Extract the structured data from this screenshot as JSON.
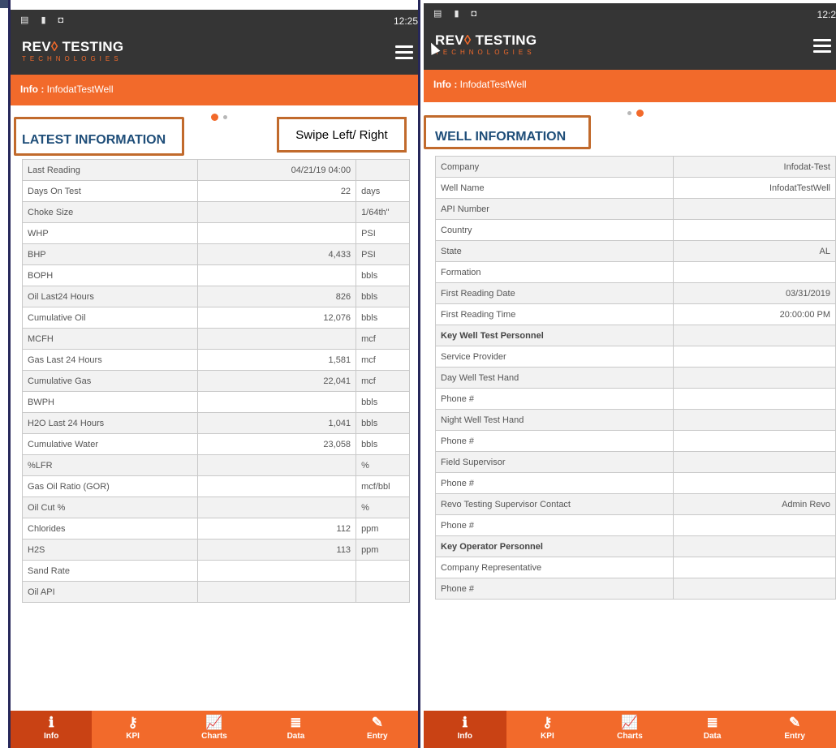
{
  "left": {
    "time": "12:25",
    "brand": {
      "part1": "REV",
      "drop": "◊",
      "part2": " TESTING",
      "sub": "TECHNOLOGIES"
    },
    "info_label": "Info :",
    "well_name": "InfodatTestWell",
    "heading": "LATEST INFORMATION",
    "swipe_hint": "Swipe Left/ Right",
    "rows": [
      {
        "label": "Last Reading",
        "value": "04/21/19 04:00",
        "unit": ""
      },
      {
        "label": "Days On Test",
        "value": "22",
        "unit": "days"
      },
      {
        "label": "Choke Size",
        "value": "",
        "unit": "1/64th\""
      },
      {
        "label": "WHP",
        "value": "",
        "unit": "PSI"
      },
      {
        "label": "BHP",
        "value": "4,433",
        "unit": "PSI"
      },
      {
        "label": "BOPH",
        "value": "",
        "unit": "bbls"
      },
      {
        "label": "Oil Last24 Hours",
        "value": "826",
        "unit": "bbls"
      },
      {
        "label": "Cumulative Oil",
        "value": "12,076",
        "unit": "bbls"
      },
      {
        "label": "MCFH",
        "value": "",
        "unit": "mcf"
      },
      {
        "label": "Gas Last 24 Hours",
        "value": "1,581",
        "unit": "mcf"
      },
      {
        "label": "Cumulative Gas",
        "value": "22,041",
        "unit": "mcf"
      },
      {
        "label": "BWPH",
        "value": "",
        "unit": "bbls"
      },
      {
        "label": "H2O Last 24 Hours",
        "value": "1,041",
        "unit": "bbls"
      },
      {
        "label": "Cumulative Water",
        "value": "23,058",
        "unit": "bbls"
      },
      {
        "label": "%LFR",
        "value": "",
        "unit": "%"
      },
      {
        "label": "Gas Oil Ratio (GOR)",
        "value": "",
        "unit": "mcf/bbl"
      },
      {
        "label": "Oil Cut %",
        "value": "",
        "unit": "%"
      },
      {
        "label": "Chlorides",
        "value": "112",
        "unit": "ppm"
      },
      {
        "label": "H2S",
        "value": "113",
        "unit": "ppm"
      },
      {
        "label": "Sand Rate",
        "value": "",
        "unit": ""
      },
      {
        "label": "Oil API",
        "value": "",
        "unit": ""
      }
    ]
  },
  "right": {
    "time": "12:2",
    "brand": {
      "part1": "REV",
      "drop": "◊",
      "part2": " TESTING",
      "sub": "TECHNOLOGIES"
    },
    "info_label": "Info :",
    "well_name": "InfodatTestWell",
    "heading": "WELL INFORMATION",
    "rows": [
      {
        "label": "Company",
        "value": "Infodat-Test",
        "bold": false
      },
      {
        "label": "Well Name",
        "value": "InfodatTestWell",
        "bold": false
      },
      {
        "label": "API Number",
        "value": "",
        "bold": false
      },
      {
        "label": "Country",
        "value": "",
        "bold": false
      },
      {
        "label": "State",
        "value": "AL",
        "bold": false
      },
      {
        "label": "Formation",
        "value": "",
        "bold": false
      },
      {
        "label": "First Reading Date",
        "value": "03/31/2019",
        "bold": false
      },
      {
        "label": "First Reading Time",
        "value": "20:00:00 PM",
        "bold": false
      },
      {
        "label": "Key Well Test Personnel",
        "value": "",
        "bold": true
      },
      {
        "label": "Service Provider",
        "value": "",
        "bold": false
      },
      {
        "label": "Day Well Test Hand",
        "value": "",
        "bold": false
      },
      {
        "label": "Phone #",
        "value": "",
        "bold": false
      },
      {
        "label": "Night Well Test Hand",
        "value": "",
        "bold": false
      },
      {
        "label": "Phone #",
        "value": "",
        "bold": false
      },
      {
        "label": "Field Supervisor",
        "value": "",
        "bold": false
      },
      {
        "label": "Phone #",
        "value": "",
        "bold": false
      },
      {
        "label": "Revo Testing Supervisor Contact",
        "value": "Admin Revo",
        "bold": false
      },
      {
        "label": "Phone #",
        "value": "",
        "bold": false
      },
      {
        "label": "Key Operator Personnel",
        "value": "",
        "bold": true
      },
      {
        "label": "Company Representative",
        "value": "",
        "bold": false
      },
      {
        "label": "Phone #",
        "value": "",
        "bold": false
      }
    ]
  },
  "nav": [
    {
      "label": "Info",
      "icon": "info-icon",
      "glyph": "ℹ"
    },
    {
      "label": "KPI",
      "icon": "key-icon",
      "glyph": "⚷"
    },
    {
      "label": "Charts",
      "icon": "chart-icon",
      "glyph": "📈"
    },
    {
      "label": "Data",
      "icon": "database-icon",
      "glyph": "≣"
    },
    {
      "label": "Entry",
      "icon": "edit-icon",
      "glyph": "✎"
    }
  ],
  "colors": {
    "accent": "#f26a2b",
    "appbar": "#353535",
    "heading": "#1f4e79",
    "highlight_box": "#c16a2c",
    "active_nav": "#c94214"
  }
}
